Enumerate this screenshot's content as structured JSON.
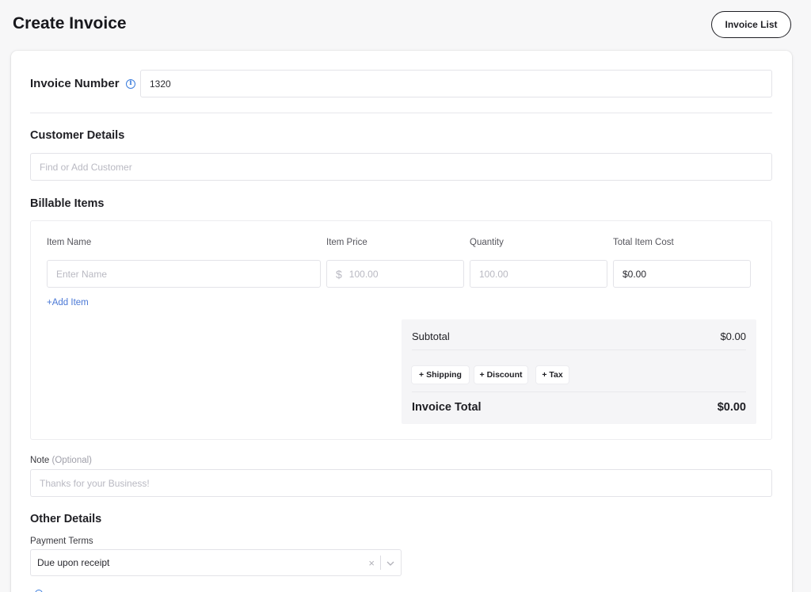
{
  "header": {
    "title": "Create Invoice",
    "invoice_list_label": "Invoice List"
  },
  "invoice_number": {
    "label": "Invoice Number",
    "info_glyph": "i",
    "value": "1320"
  },
  "customer": {
    "title": "Customer Details",
    "placeholder": "Find or Add Customer"
  },
  "billable": {
    "title": "Billable Items",
    "columns": [
      "Item Name",
      "Item Price",
      "Quantity",
      "Total Item Cost"
    ],
    "row": {
      "name_placeholder": "Enter Name",
      "currency_symbol": "$",
      "price_placeholder": "100.00",
      "quantity_placeholder": "100.00",
      "total_value": "$0.00"
    },
    "add_item_label": "+Add Item"
  },
  "totals": {
    "subtotal_label": "Subtotal",
    "subtotal_value": "$0.00",
    "shipping_label": "+ Shipping",
    "discount_label": "+ Discount",
    "tax_label": "+ Tax",
    "total_label": "Invoice Total",
    "total_value": "$0.00"
  },
  "note": {
    "label": "Note",
    "optional": "(Optional)",
    "placeholder": "Thanks for your Business!"
  },
  "other": {
    "title": "Other Details",
    "payment_terms_label": "Payment Terms",
    "payment_terms_value": "Due upon receipt",
    "clear_glyph": "×"
  },
  "colors": {
    "accent": "#3b7ddd",
    "link": "#4a78d6",
    "border": "#e3e3e8",
    "totals_bg": "#f5f5f7"
  },
  "icons": [
    "info-icon",
    "dollar-icon",
    "clear-icon",
    "chevron-down-icon",
    "radio-icon"
  ]
}
